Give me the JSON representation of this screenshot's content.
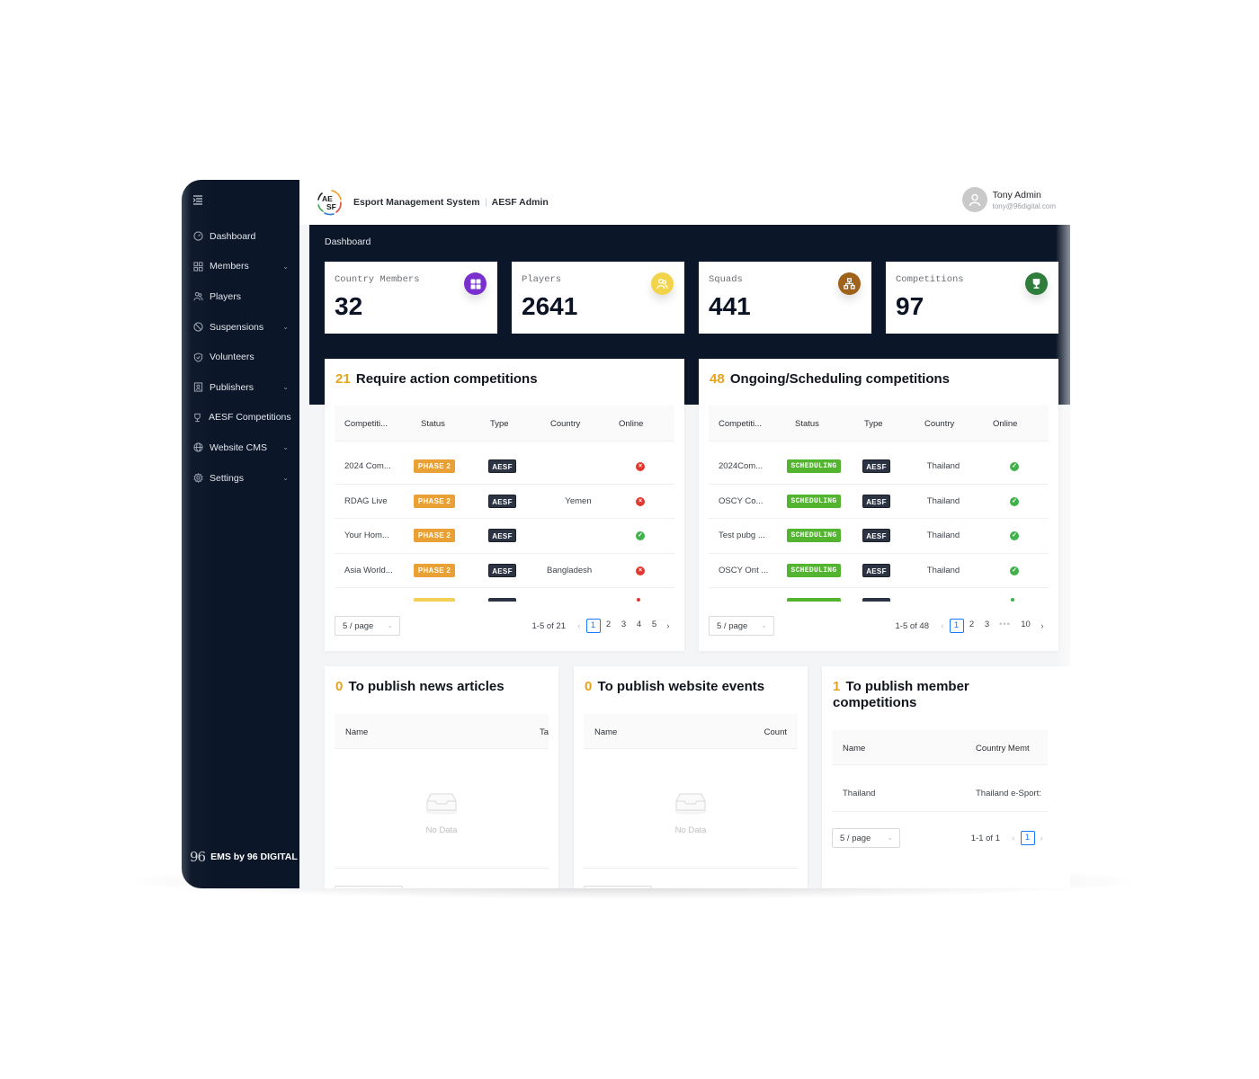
{
  "app": {
    "logo_text_top": "AE",
    "logo_text_bottom": "SF",
    "title": "Esport Management System",
    "subtitle": "AESF Admin"
  },
  "user": {
    "name": "Tony Admin",
    "email": "tony@96digital.com"
  },
  "sidebar": {
    "items": [
      {
        "label": "Dashboard",
        "icon": "dashboard-icon",
        "has_submenu": false
      },
      {
        "label": "Members",
        "icon": "grid-icon",
        "has_submenu": true
      },
      {
        "label": "Players",
        "icon": "players-icon",
        "has_submenu": false
      },
      {
        "label": "Suspensions",
        "icon": "ban-icon",
        "has_submenu": true
      },
      {
        "label": "Volunteers",
        "icon": "shield-check-icon",
        "has_submenu": false
      },
      {
        "label": "Publishers",
        "icon": "publisher-icon",
        "has_submenu": true
      },
      {
        "label": "AESF Competitions",
        "icon": "trophy-icon",
        "has_submenu": false
      },
      {
        "label": "Website CMS",
        "icon": "globe-icon",
        "has_submenu": true
      },
      {
        "label": "Settings",
        "icon": "gear-icon",
        "has_submenu": true
      }
    ],
    "footer_logo": "96",
    "footer_label": "EMS by 96 DIGITAL"
  },
  "breadcrumb": "Dashboard",
  "stats": [
    {
      "label": "Country Members",
      "value": "32",
      "icon": "grid-icon",
      "color": "#7a2fcf"
    },
    {
      "label": "Players",
      "value": "2641",
      "icon": "players-icon",
      "color": "#f3d34a"
    },
    {
      "label": "Squads",
      "value": "441",
      "icon": "hierarchy-icon",
      "color": "#a0621a"
    },
    {
      "label": "Competitions",
      "value": "97",
      "icon": "trophy-icon",
      "color": "#2e7d3a"
    }
  ],
  "require_action": {
    "count": "21",
    "title": "Require action competitions",
    "columns": [
      "Competiti...",
      "Status",
      "Type",
      "Country",
      "Online"
    ],
    "rows": [
      {
        "name": "2024 Com...",
        "status": "PHASE  2",
        "type": "AESF",
        "country": "",
        "online": false
      },
      {
        "name": "RDAG Live",
        "status": "PHASE  2",
        "type": "AESF",
        "country": "Yemen",
        "online": false
      },
      {
        "name": "Your Hom...",
        "status": "PHASE  2",
        "type": "AESF",
        "country": "",
        "online": true
      },
      {
        "name": "Asia World...",
        "status": "PHASE  2",
        "type": "AESF",
        "country": "Bangladesh",
        "online": false
      }
    ],
    "page_size": "5 / page",
    "range": "1-5 of 21",
    "pages": [
      "1",
      "2",
      "3",
      "4",
      "5"
    ],
    "current_page": "1"
  },
  "ongoing": {
    "count": "48",
    "title": "Ongoing/Scheduling competitions",
    "columns": [
      "Competiti...",
      "Status",
      "Type",
      "Country",
      "Online"
    ],
    "rows": [
      {
        "name": "2024Com...",
        "status": "SCHEDULING",
        "type": "AESF",
        "country": "Thailand",
        "online": true
      },
      {
        "name": "OSCY Co...",
        "status": "SCHEDULING",
        "type": "AESF",
        "country": "Thailand",
        "online": true
      },
      {
        "name": "Test pubg ...",
        "status": "SCHEDULING",
        "type": "AESF",
        "country": "Thailand",
        "online": true
      },
      {
        "name": "OSCY Ont ...",
        "status": "SCHEDULING",
        "type": "AESF",
        "country": "Thailand",
        "online": true
      }
    ],
    "page_size": "5 / page",
    "range": "1-5 of 48",
    "pages": [
      "1",
      "2",
      "3",
      "•••",
      "10"
    ],
    "current_page": "1"
  },
  "news": {
    "count": "0",
    "title": "To publish news articles",
    "columns": [
      "Name",
      "Ta"
    ],
    "empty_text": "No Data"
  },
  "events": {
    "count": "0",
    "title": "To publish website events",
    "columns": [
      "Name",
      "Count"
    ],
    "empty_text": "No Data"
  },
  "member_comps": {
    "count": "1",
    "title_line1": "To publish member",
    "title_line2": "competitions",
    "columns": [
      "Name",
      "Country Memt"
    ],
    "rows": [
      {
        "name": "Thailand",
        "country_member": "Thailand e-Sport:"
      }
    ],
    "page_size": "5 / page",
    "range": "1-1 of 1",
    "pages": [
      "1"
    ],
    "current_page": "1"
  },
  "colors": {
    "accent_count": "#e7a31b",
    "phase_tag": "#e9a034",
    "scheduling_tag": "#52b42f",
    "aesf_tag": "#2c3444",
    "offline": "#e2382f",
    "online": "#3fb24a",
    "navy": "#0b1628",
    "pagination_active": "#1677ff"
  }
}
